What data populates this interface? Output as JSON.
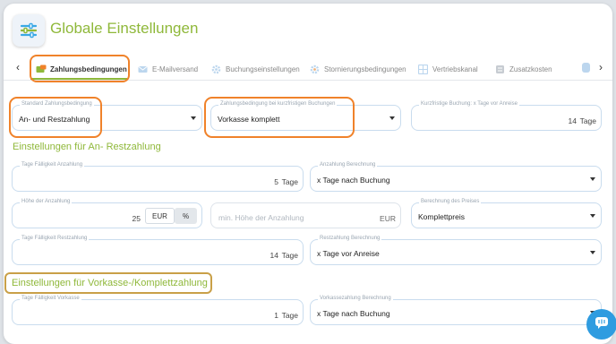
{
  "header": {
    "title": "Globale Einstellungen"
  },
  "tabs": [
    {
      "label": "Zahlungsbedingungen",
      "icon": "payment-icon",
      "active": true
    },
    {
      "label": "E-Mailversand",
      "icon": "mail-icon"
    },
    {
      "label": "Buchungseinstellungen",
      "icon": "gear-icon"
    },
    {
      "label": "Stornierungsbedingungen",
      "icon": "cancel-gear-icon"
    },
    {
      "label": "Vertriebskanal",
      "icon": "grid-icon"
    },
    {
      "label": "Zusatzkosten",
      "icon": "cost-icon"
    }
  ],
  "top_row": {
    "standard": {
      "label": "Standard Zahlungsbedingung",
      "value": "An- und Restzahlung"
    },
    "kurzfristig": {
      "label": "Zahlungsbedingung bei kurzfristigen Buchungen",
      "value": "Vorkasse komplett"
    },
    "kurzfristige_buchung": {
      "label": "Kurzfristige Buchung: x Tage vor Anreise",
      "value": "14",
      "unit": "Tage"
    }
  },
  "section_an_rest": {
    "title": "Einstellungen für An- Restzahlung",
    "tage_faelligkeit_anzahlung": {
      "label": "Tage Fälligkeit Anzahlung",
      "value": "5",
      "unit": "Tage"
    },
    "anzahlung_berechnung": {
      "label": "Anzahlung Berechnung",
      "value": "x Tage nach Buchung"
    },
    "hoehe_anzahlung": {
      "label": "Höhe der Anzahlung",
      "value": "25",
      "opt_eur": "EUR",
      "opt_pct": "%"
    },
    "min_hoehe": {
      "placeholder": "min. Höhe der Anzahlung",
      "unit": "EUR"
    },
    "berechnung_preis": {
      "label": "Berechnung des Preises",
      "value": "Komplettpreis"
    },
    "tage_faelligkeit_rest": {
      "label": "Tage Fälligkeit Restzahlung",
      "value": "14",
      "unit": "Tage"
    },
    "restzahlung_berechnung": {
      "label": "Restzahlung Berechnung",
      "value": "x Tage vor Anreise"
    }
  },
  "section_vorkasse": {
    "title": "Einstellungen für Vorkasse-/Komplettzahlung",
    "tage_faelligkeit_vorkasse": {
      "label": "Tage Fälligkeit Vorkasse",
      "value": "1",
      "unit": "Tage"
    },
    "vorkassezahlung_berechnung": {
      "label": "Vorkassezahlung Berechnung",
      "value": "x Tage nach Buchung"
    }
  },
  "colors": {
    "accent_green": "#8fb83a",
    "highlight_orange": "#f0822a",
    "highlight_brown": "#c9a048",
    "chat_blue": "#2f9ce0"
  }
}
